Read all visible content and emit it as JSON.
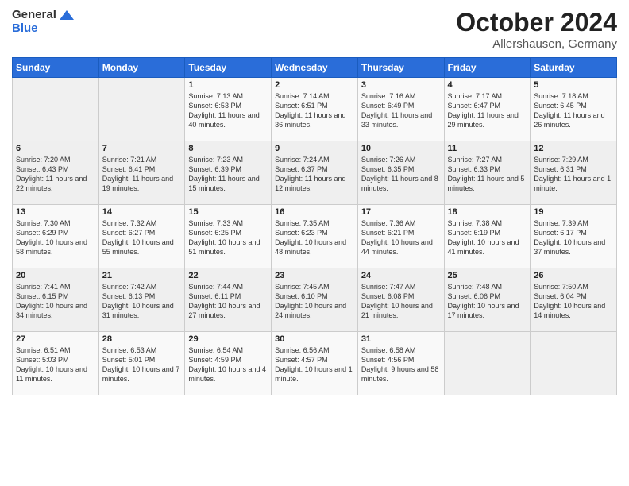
{
  "logo": {
    "general": "General",
    "blue": "Blue"
  },
  "title": "October 2024",
  "subtitle": "Allershausen, Germany",
  "days_of_week": [
    "Sunday",
    "Monday",
    "Tuesday",
    "Wednesday",
    "Thursday",
    "Friday",
    "Saturday"
  ],
  "weeks": [
    [
      {
        "day": "",
        "sunrise": "",
        "sunset": "",
        "daylight": ""
      },
      {
        "day": "",
        "sunrise": "",
        "sunset": "",
        "daylight": ""
      },
      {
        "day": "1",
        "sunrise": "Sunrise: 7:13 AM",
        "sunset": "Sunset: 6:53 PM",
        "daylight": "Daylight: 11 hours and 40 minutes."
      },
      {
        "day": "2",
        "sunrise": "Sunrise: 7:14 AM",
        "sunset": "Sunset: 6:51 PM",
        "daylight": "Daylight: 11 hours and 36 minutes."
      },
      {
        "day": "3",
        "sunrise": "Sunrise: 7:16 AM",
        "sunset": "Sunset: 6:49 PM",
        "daylight": "Daylight: 11 hours and 33 minutes."
      },
      {
        "day": "4",
        "sunrise": "Sunrise: 7:17 AM",
        "sunset": "Sunset: 6:47 PM",
        "daylight": "Daylight: 11 hours and 29 minutes."
      },
      {
        "day": "5",
        "sunrise": "Sunrise: 7:18 AM",
        "sunset": "Sunset: 6:45 PM",
        "daylight": "Daylight: 11 hours and 26 minutes."
      }
    ],
    [
      {
        "day": "6",
        "sunrise": "Sunrise: 7:20 AM",
        "sunset": "Sunset: 6:43 PM",
        "daylight": "Daylight: 11 hours and 22 minutes."
      },
      {
        "day": "7",
        "sunrise": "Sunrise: 7:21 AM",
        "sunset": "Sunset: 6:41 PM",
        "daylight": "Daylight: 11 hours and 19 minutes."
      },
      {
        "day": "8",
        "sunrise": "Sunrise: 7:23 AM",
        "sunset": "Sunset: 6:39 PM",
        "daylight": "Daylight: 11 hours and 15 minutes."
      },
      {
        "day": "9",
        "sunrise": "Sunrise: 7:24 AM",
        "sunset": "Sunset: 6:37 PM",
        "daylight": "Daylight: 11 hours and 12 minutes."
      },
      {
        "day": "10",
        "sunrise": "Sunrise: 7:26 AM",
        "sunset": "Sunset: 6:35 PM",
        "daylight": "Daylight: 11 hours and 8 minutes."
      },
      {
        "day": "11",
        "sunrise": "Sunrise: 7:27 AM",
        "sunset": "Sunset: 6:33 PM",
        "daylight": "Daylight: 11 hours and 5 minutes."
      },
      {
        "day": "12",
        "sunrise": "Sunrise: 7:29 AM",
        "sunset": "Sunset: 6:31 PM",
        "daylight": "Daylight: 11 hours and 1 minute."
      }
    ],
    [
      {
        "day": "13",
        "sunrise": "Sunrise: 7:30 AM",
        "sunset": "Sunset: 6:29 PM",
        "daylight": "Daylight: 10 hours and 58 minutes."
      },
      {
        "day": "14",
        "sunrise": "Sunrise: 7:32 AM",
        "sunset": "Sunset: 6:27 PM",
        "daylight": "Daylight: 10 hours and 55 minutes."
      },
      {
        "day": "15",
        "sunrise": "Sunrise: 7:33 AM",
        "sunset": "Sunset: 6:25 PM",
        "daylight": "Daylight: 10 hours and 51 minutes."
      },
      {
        "day": "16",
        "sunrise": "Sunrise: 7:35 AM",
        "sunset": "Sunset: 6:23 PM",
        "daylight": "Daylight: 10 hours and 48 minutes."
      },
      {
        "day": "17",
        "sunrise": "Sunrise: 7:36 AM",
        "sunset": "Sunset: 6:21 PM",
        "daylight": "Daylight: 10 hours and 44 minutes."
      },
      {
        "day": "18",
        "sunrise": "Sunrise: 7:38 AM",
        "sunset": "Sunset: 6:19 PM",
        "daylight": "Daylight: 10 hours and 41 minutes."
      },
      {
        "day": "19",
        "sunrise": "Sunrise: 7:39 AM",
        "sunset": "Sunset: 6:17 PM",
        "daylight": "Daylight: 10 hours and 37 minutes."
      }
    ],
    [
      {
        "day": "20",
        "sunrise": "Sunrise: 7:41 AM",
        "sunset": "Sunset: 6:15 PM",
        "daylight": "Daylight: 10 hours and 34 minutes."
      },
      {
        "day": "21",
        "sunrise": "Sunrise: 7:42 AM",
        "sunset": "Sunset: 6:13 PM",
        "daylight": "Daylight: 10 hours and 31 minutes."
      },
      {
        "day": "22",
        "sunrise": "Sunrise: 7:44 AM",
        "sunset": "Sunset: 6:11 PM",
        "daylight": "Daylight: 10 hours and 27 minutes."
      },
      {
        "day": "23",
        "sunrise": "Sunrise: 7:45 AM",
        "sunset": "Sunset: 6:10 PM",
        "daylight": "Daylight: 10 hours and 24 minutes."
      },
      {
        "day": "24",
        "sunrise": "Sunrise: 7:47 AM",
        "sunset": "Sunset: 6:08 PM",
        "daylight": "Daylight: 10 hours and 21 minutes."
      },
      {
        "day": "25",
        "sunrise": "Sunrise: 7:48 AM",
        "sunset": "Sunset: 6:06 PM",
        "daylight": "Daylight: 10 hours and 17 minutes."
      },
      {
        "day": "26",
        "sunrise": "Sunrise: 7:50 AM",
        "sunset": "Sunset: 6:04 PM",
        "daylight": "Daylight: 10 hours and 14 minutes."
      }
    ],
    [
      {
        "day": "27",
        "sunrise": "Sunrise: 6:51 AM",
        "sunset": "Sunset: 5:03 PM",
        "daylight": "Daylight: 10 hours and 11 minutes."
      },
      {
        "day": "28",
        "sunrise": "Sunrise: 6:53 AM",
        "sunset": "Sunset: 5:01 PM",
        "daylight": "Daylight: 10 hours and 7 minutes."
      },
      {
        "day": "29",
        "sunrise": "Sunrise: 6:54 AM",
        "sunset": "Sunset: 4:59 PM",
        "daylight": "Daylight: 10 hours and 4 minutes."
      },
      {
        "day": "30",
        "sunrise": "Sunrise: 6:56 AM",
        "sunset": "Sunset: 4:57 PM",
        "daylight": "Daylight: 10 hours and 1 minute."
      },
      {
        "day": "31",
        "sunrise": "Sunrise: 6:58 AM",
        "sunset": "Sunset: 4:56 PM",
        "daylight": "Daylight: 9 hours and 58 minutes."
      },
      {
        "day": "",
        "sunrise": "",
        "sunset": "",
        "daylight": ""
      },
      {
        "day": "",
        "sunrise": "",
        "sunset": "",
        "daylight": ""
      }
    ]
  ]
}
